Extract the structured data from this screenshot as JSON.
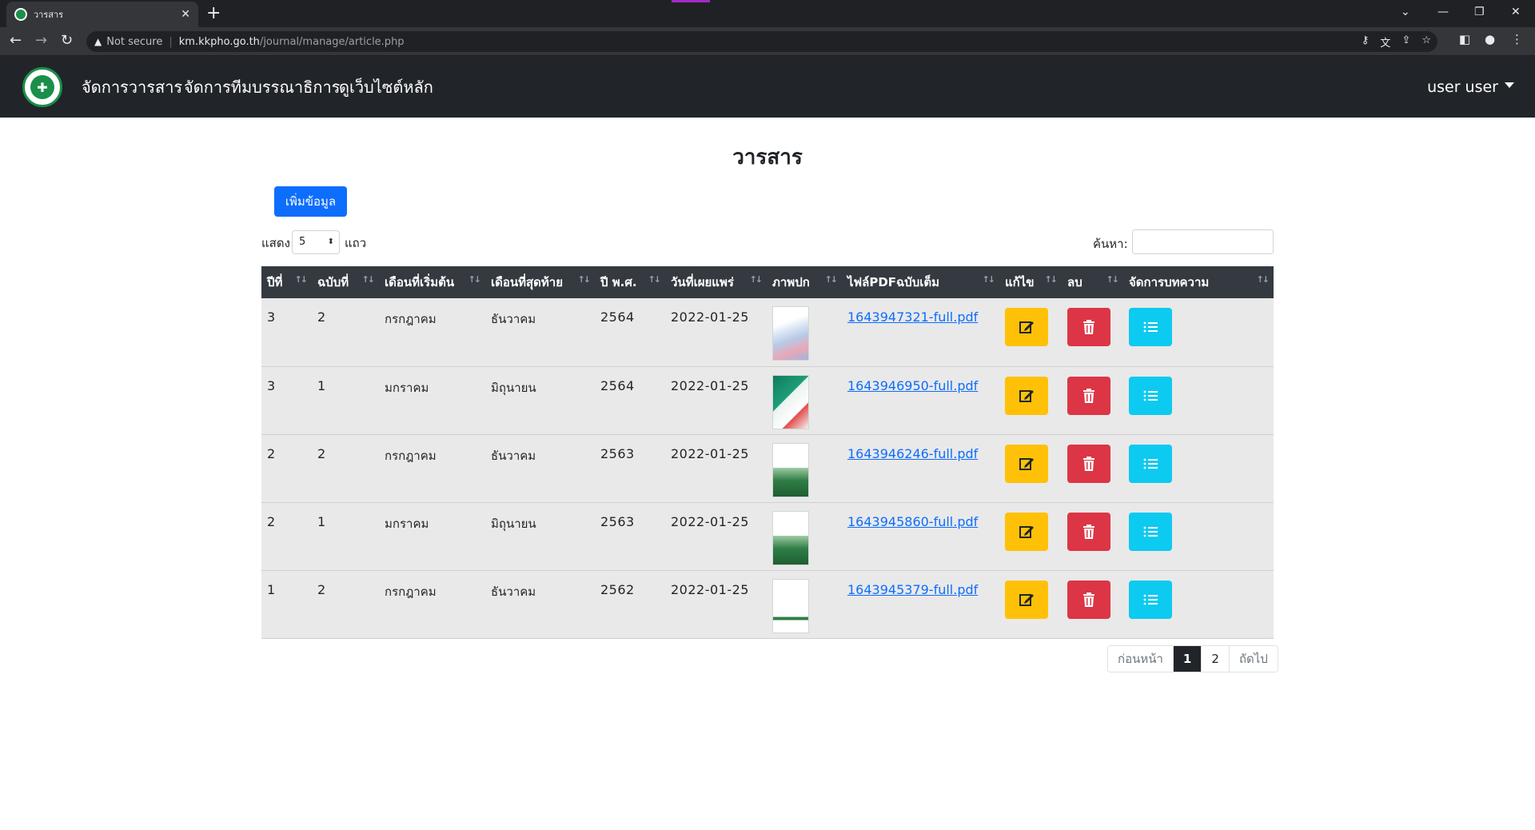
{
  "browser": {
    "tab_title": "วารสาร",
    "url_security": "Not secure",
    "url_host": "km.kkpho.go.th",
    "url_path": "/journal/manage/article.php"
  },
  "navbar": {
    "links": [
      "จัดการวารสาร",
      "จัดการทีมบรรณาธิการ",
      "ดูเว็บไซต์หลัก"
    ],
    "user_label": "user user"
  },
  "page": {
    "title": "วารสาร",
    "add_button": "เพิ่มข้อมูล",
    "show_label": "แสดง",
    "show_value": "5",
    "rows_label": "แถว",
    "search_label": "ค้นหา:"
  },
  "table": {
    "headers": [
      "ปีที่",
      "ฉบับที่",
      "เดือนที่เริ่มต้น",
      "เดือนที่สุดท้าย",
      "ปี พ.ศ.",
      "วันที่เผยแพร่",
      "ภาพปก",
      "ไฟล์PDFฉบับเต็ม",
      "แก้ไข",
      "ลบ",
      "จัดการบทความ"
    ],
    "rows": [
      {
        "year_no": "3",
        "issue": "2",
        "start_month": "กรกฎาคม",
        "end_month": "ธันวาคม",
        "be_year": "2564",
        "published": "2022-01-25",
        "pdf": "1643947321-full.pdf"
      },
      {
        "year_no": "3",
        "issue": "1",
        "start_month": "มกราคม",
        "end_month": "มิถุนายน",
        "be_year": "2564",
        "published": "2022-01-25",
        "pdf": "1643946950-full.pdf"
      },
      {
        "year_no": "2",
        "issue": "2",
        "start_month": "กรกฎาคม",
        "end_month": "ธันวาคม",
        "be_year": "2563",
        "published": "2022-01-25",
        "pdf": "1643946246-full.pdf"
      },
      {
        "year_no": "2",
        "issue": "1",
        "start_month": "มกราคม",
        "end_month": "มิถุนายน",
        "be_year": "2563",
        "published": "2022-01-25",
        "pdf": "1643945860-full.pdf"
      },
      {
        "year_no": "1",
        "issue": "2",
        "start_month": "กรกฎาคม",
        "end_month": "ธันวาคม",
        "be_year": "2562",
        "published": "2022-01-25",
        "pdf": "1643945379-full.pdf"
      }
    ]
  },
  "pagination": {
    "prev": "ก่อนหน้า",
    "pages": [
      "1",
      "2"
    ],
    "current": "1",
    "next": "ถัดไป"
  },
  "colors": {
    "navbar": "#212529",
    "primary": "#0d6efd",
    "edit": "#ffc107",
    "delete": "#dc3545",
    "manage": "#0dcaf0"
  },
  "icons": [
    "edit-icon",
    "trash-icon",
    "list-icon",
    "sort-icon",
    "logo-icon"
  ]
}
